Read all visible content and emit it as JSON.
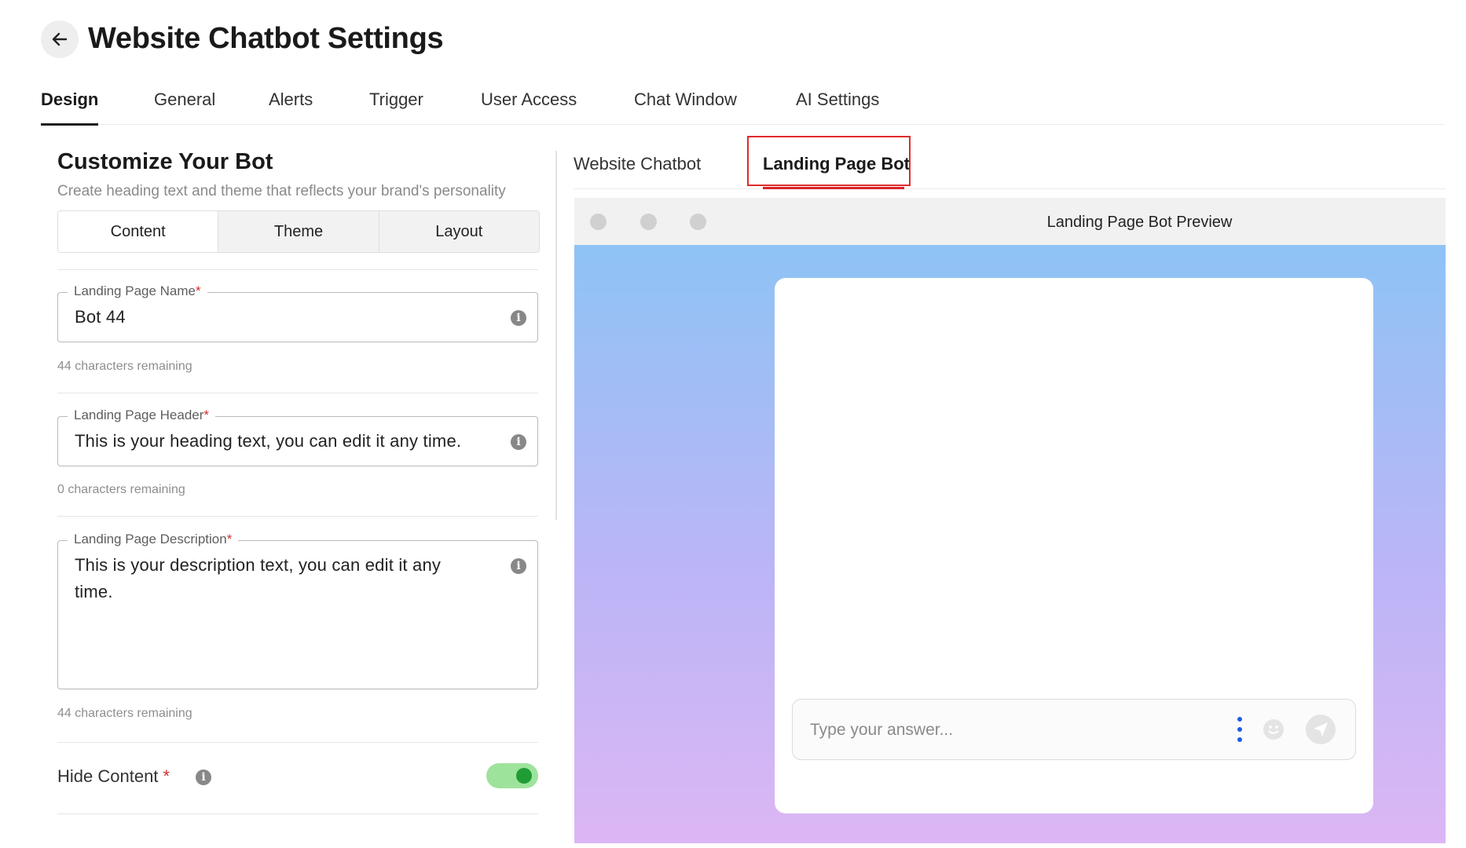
{
  "header": {
    "title": "Website Chatbot Settings"
  },
  "tabs": [
    {
      "label": "Design",
      "active": true
    },
    {
      "label": "General"
    },
    {
      "label": "Alerts"
    },
    {
      "label": "Trigger"
    },
    {
      "label": "User Access"
    },
    {
      "label": "Chat Window"
    },
    {
      "label": "AI Settings"
    }
  ],
  "customize": {
    "title": "Customize Your Bot",
    "subtitle": "Create heading text and theme that reflects your brand's personality",
    "segments": [
      {
        "label": "Content",
        "active": true
      },
      {
        "label": "Theme"
      },
      {
        "label": "Layout"
      }
    ]
  },
  "fields": {
    "name": {
      "label": "Landing Page Name",
      "required_mark": "*",
      "value": "Bot 44",
      "helper": "44 characters remaining"
    },
    "header": {
      "label": "Landing Page Header",
      "required_mark": "*",
      "value": "This is your heading text, you can edit it any time.",
      "helper": "0 characters remaining"
    },
    "description": {
      "label": "Landing Page Description",
      "required_mark": "*",
      "value": "This is your description text, you can edit it any time.",
      "helper": "44 characters remaining"
    }
  },
  "hide_content": {
    "label": "Hide Content",
    "required_mark": "*",
    "enabled": true
  },
  "bot_tabs": [
    {
      "label": "Website Chatbot"
    },
    {
      "label": "Landing Page Bot",
      "active": true,
      "highlighted": true
    }
  ],
  "preview": {
    "title": "Landing Page Bot Preview",
    "input_placeholder": "Type your answer..."
  },
  "colors": {
    "toggle_on": "#1f9d34",
    "highlight_border": "#e02b2b",
    "gradient_top": "#8ec3f5",
    "gradient_bottom": "#dcb6f4",
    "menu_dots": "#1e5fe0"
  },
  "icons": {
    "back": "arrow-left-icon",
    "info": "info-icon",
    "menu": "kebab-menu-icon",
    "emoji": "emoji-icon",
    "send": "send-icon"
  }
}
